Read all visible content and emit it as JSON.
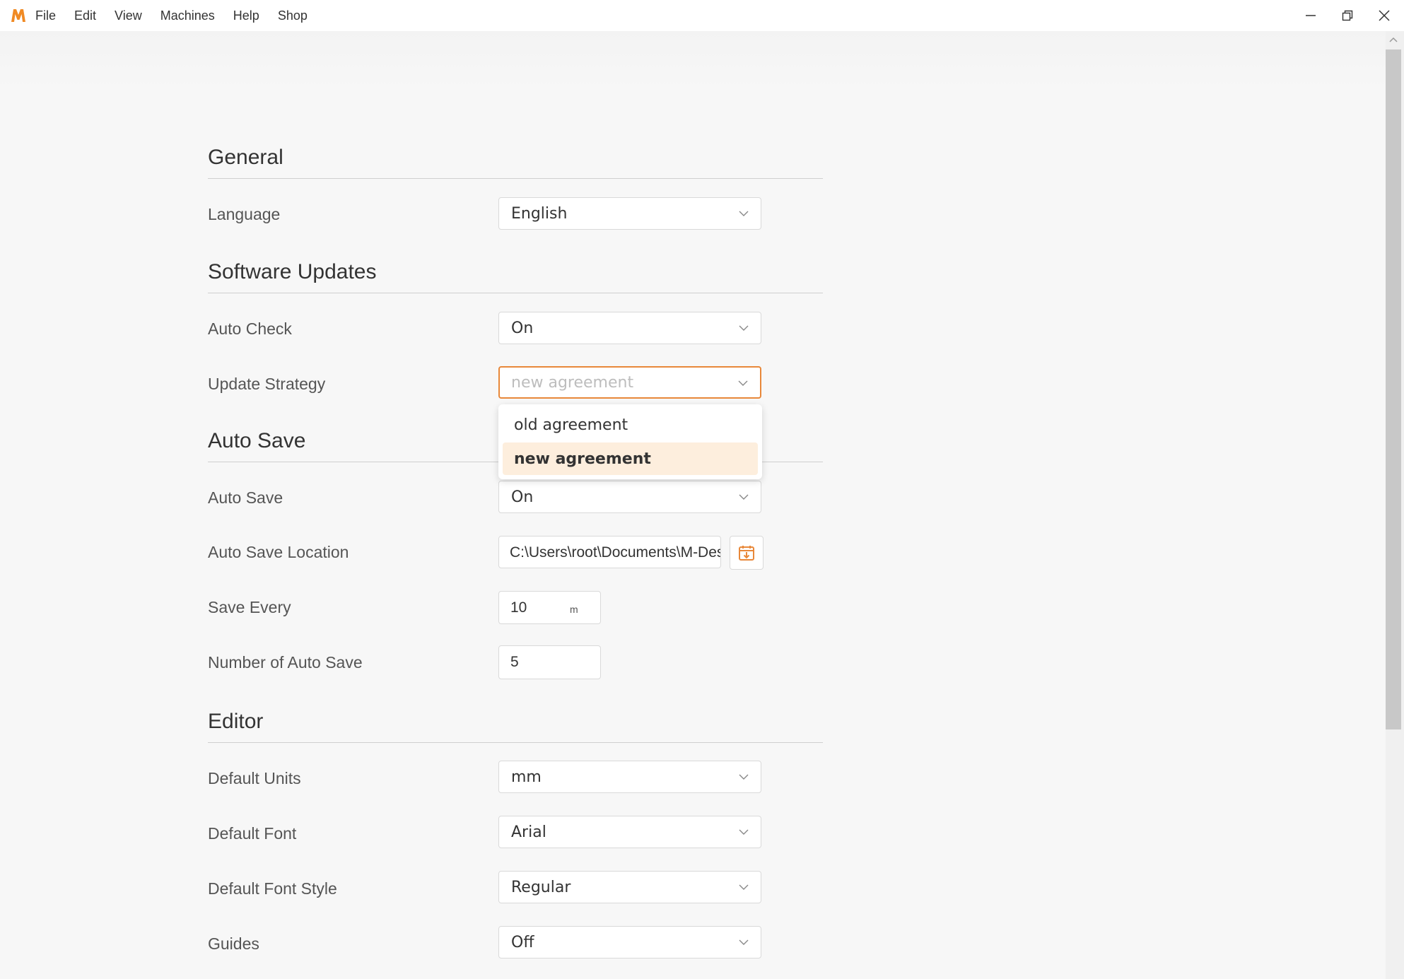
{
  "menu": {
    "items": [
      "File",
      "Edit",
      "View",
      "Machines",
      "Help",
      "Shop"
    ]
  },
  "icons": {
    "logo": "app-logo-m",
    "minimize": "minimize-icon",
    "maximize": "restore-icon",
    "close": "close-icon",
    "chevron": "chevron-down-icon",
    "folder": "folder-download-icon"
  },
  "colors": {
    "accent": "#e8883a",
    "option_highlight": "#fdeedd"
  },
  "general": {
    "title": "General",
    "language_label": "Language",
    "language_value": "English"
  },
  "updates": {
    "title": "Software Updates",
    "auto_check_label": "Auto Check",
    "auto_check_value": "On",
    "strategy_label": "Update Strategy",
    "strategy_placeholder": "new agreement",
    "options": [
      "old agreement",
      "new agreement"
    ],
    "selected_option": "new agreement"
  },
  "autosave": {
    "title": "Auto Save",
    "auto_save_label": "Auto Save",
    "auto_save_value": "On",
    "location_label": "Auto Save Location",
    "location_value": "C:\\Users\\root\\Documents\\M-Des",
    "save_every_label": "Save Every",
    "save_every_value": "10",
    "save_every_unit": "m",
    "count_label": "Number of Auto Save",
    "count_value": "5"
  },
  "editor": {
    "title": "Editor",
    "units_label": "Default Units",
    "units_value": "mm",
    "font_label": "Default Font",
    "font_value": "Arial",
    "font_style_label": "Default Font Style",
    "font_style_value": "Regular",
    "guides_label": "Guides",
    "guides_value": "Off"
  }
}
